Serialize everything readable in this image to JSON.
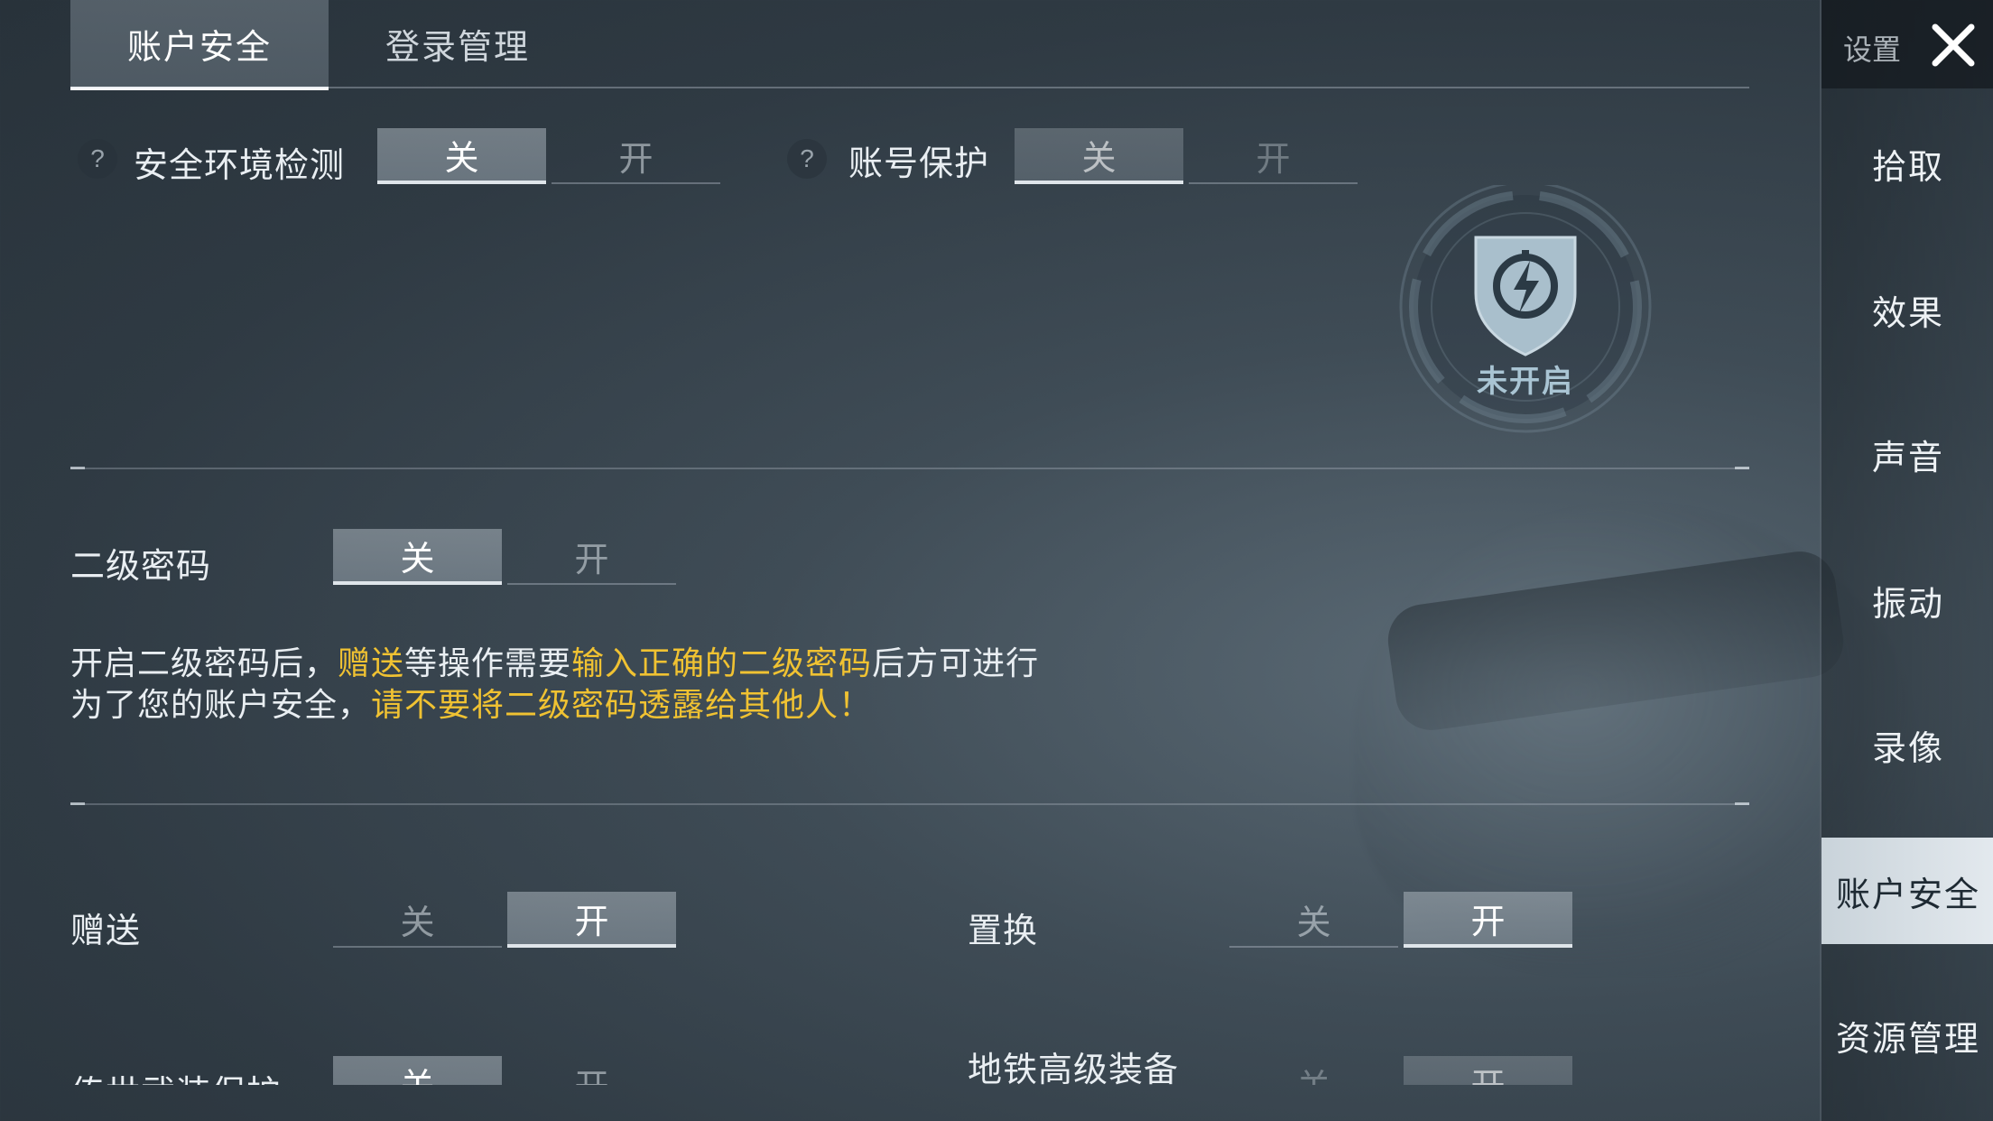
{
  "tabs": [
    {
      "label": "账户安全",
      "active": true
    },
    {
      "label": "登录管理",
      "active": false
    }
  ],
  "security_check": {
    "label": "安全环境检测",
    "help": "?",
    "off": "关",
    "on": "开",
    "state": "off"
  },
  "account_protect": {
    "label": "账号保护",
    "help": "?",
    "off": "关",
    "on": "开",
    "state": "off"
  },
  "badge": {
    "status": "未开启",
    "icon": "shield-lightning-icon"
  },
  "second_password": {
    "label": "二级密码",
    "off": "关",
    "on": "开",
    "state": "off"
  },
  "description": {
    "line1_a": "开启二级密码后，",
    "line1_b": "赠送",
    "line1_c": "等操作需要",
    "line1_d": "输入正确的二级密码",
    "line1_e": "后方可进行",
    "line2_a": "为了您的账户安全，",
    "line2_b": "请不要将二级密码透露给其他人！"
  },
  "gift": {
    "label": "赠送",
    "off": "关",
    "on": "开",
    "state": "on"
  },
  "exchange": {
    "label": "置换",
    "off": "关",
    "on": "开",
    "state": "on"
  },
  "legend_weapon": {
    "label": "传世武装保护",
    "off": "关",
    "on": "开",
    "state": "off"
  },
  "metro_gear": {
    "label": "地铁高级装备",
    "off": "关",
    "on": "开",
    "state": "on"
  },
  "sidebar": {
    "title": "设置",
    "items": [
      {
        "label": "拾取"
      },
      {
        "label": "效果"
      },
      {
        "label": "声音"
      },
      {
        "label": "振动"
      },
      {
        "label": "录像"
      },
      {
        "label": "账户安全",
        "active": true
      },
      {
        "label": "资源管理"
      }
    ]
  },
  "colors": {
    "highlight": "#f0c232",
    "active_sidebar": "#dde4e9"
  }
}
